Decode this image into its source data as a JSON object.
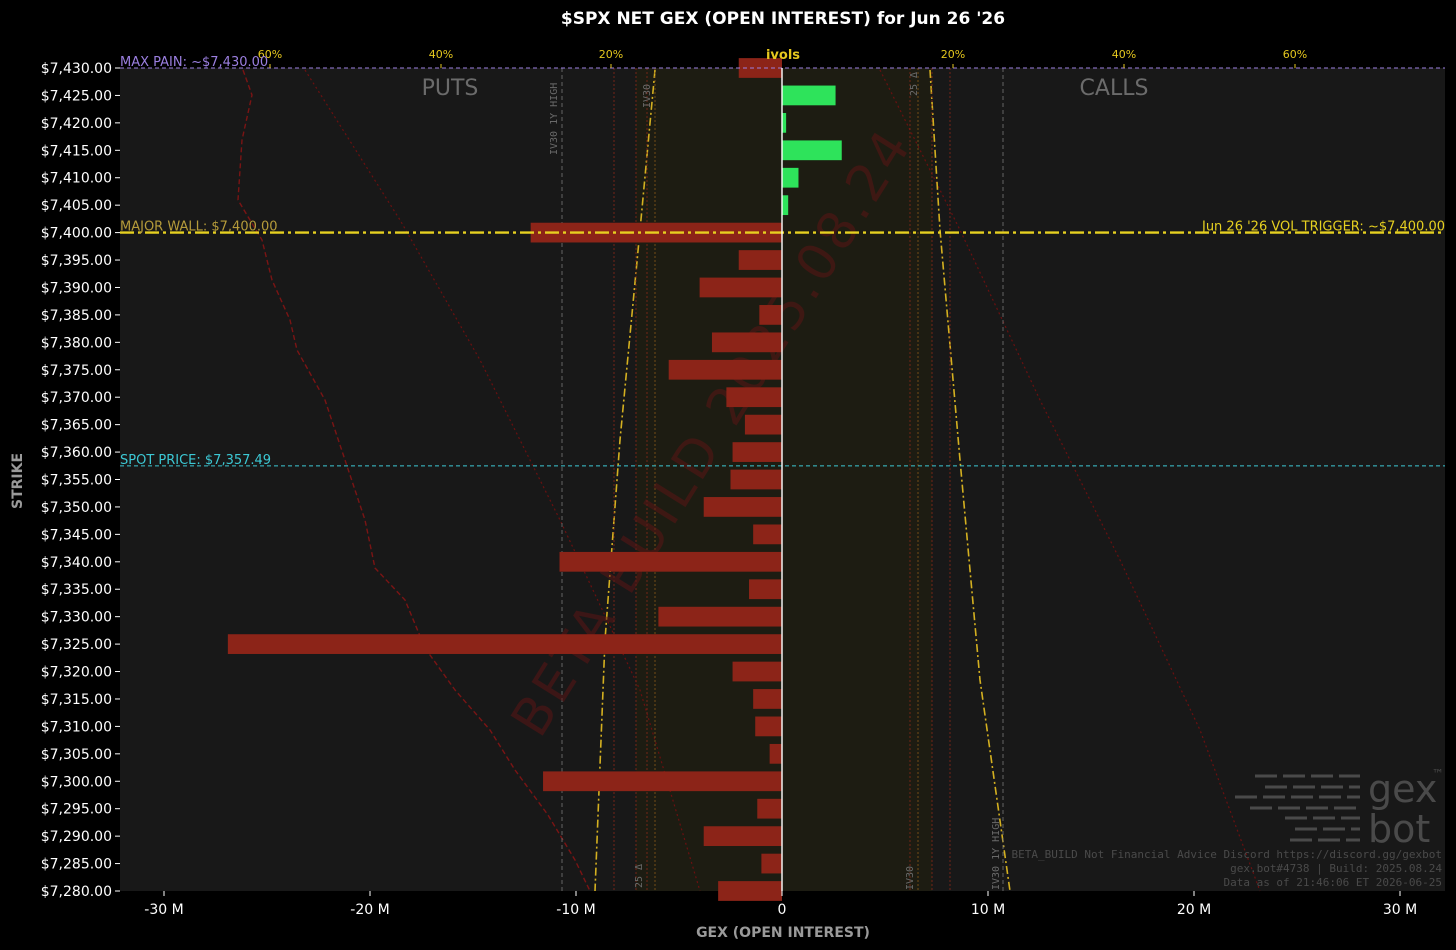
{
  "chart_data": {
    "type": "bar",
    "orientation": "horizontal",
    "title": "$SPX NET GEX (OPEN INTEREST) for Jun 26 '26",
    "xlabel": "GEX (OPEN INTEREST)",
    "ylabel": "STRIKE",
    "xlim": [
      -33,
      32
    ],
    "ylim": [
      7280,
      7430
    ],
    "x_ticks": [
      -30,
      -20,
      -10,
      0,
      10,
      20,
      30
    ],
    "x_tick_labels": [
      "-30 M",
      "-20 M",
      "-10 M",
      "0",
      "10 M",
      "20 M",
      "30 M"
    ],
    "y_ticks": [
      7430,
      7425,
      7420,
      7415,
      7410,
      7405,
      7400,
      7395,
      7390,
      7385,
      7380,
      7375,
      7370,
      7365,
      7360,
      7355,
      7350,
      7345,
      7340,
      7335,
      7330,
      7325,
      7320,
      7315,
      7310,
      7305,
      7300,
      7295,
      7290,
      7285,
      7280
    ],
    "y_tick_labels": [
      "$7,430.00",
      "$7,425.00",
      "$7,420.00",
      "$7,415.00",
      "$7,410.00",
      "$7,405.00",
      "$7,400.00",
      "$7,395.00",
      "$7,390.00",
      "$7,385.00",
      "$7,380.00",
      "$7,375.00",
      "$7,370.00",
      "$7,365.00",
      "$7,360.00",
      "$7,355.00",
      "$7,350.00",
      "$7,345.00",
      "$7,340.00",
      "$7,335.00",
      "$7,330.00",
      "$7,325.00",
      "$7,320.00",
      "$7,315.00",
      "$7,310.00",
      "$7,305.00",
      "$7,300.00",
      "$7,295.00",
      "$7,290.00",
      "$7,285.00",
      "$7,280.00"
    ],
    "strikes": [
      7430,
      7425,
      7420,
      7415,
      7410,
      7405,
      7400,
      7395,
      7390,
      7385,
      7380,
      7375,
      7370,
      7365,
      7360,
      7355,
      7350,
      7345,
      7340,
      7335,
      7330,
      7325,
      7320,
      7315,
      7310,
      7305,
      7300,
      7295,
      7290,
      7285,
      7280
    ],
    "values": [
      -2.1,
      2.6,
      0.2,
      2.9,
      0.8,
      0.3,
      -12.2,
      -2.1,
      -4.0,
      -1.1,
      -3.4,
      -5.5,
      -2.7,
      -1.8,
      -2.4,
      -2.5,
      -3.8,
      -1.4,
      -10.8,
      -1.6,
      -6.0,
      -26.9,
      -2.4,
      -1.4,
      -1.3,
      -0.6,
      -11.6,
      -1.2,
      -3.8,
      -1.0,
      -3.1
    ],
    "positive_color": "#2ee35b",
    "negative_color": "#8c2418",
    "ivol_axis": {
      "label": "ivols",
      "ticks": [
        "60%",
        "40%",
        "20%",
        "20%",
        "40%",
        "60%"
      ]
    },
    "side_labels": {
      "puts": "PUTS",
      "calls": "CALLS"
    },
    "reference_lines": {
      "max_pain": {
        "label": "MAX PAIN: ~$7,430.00",
        "strike": 7430,
        "color": "#9b7fe0"
      },
      "major_wall": {
        "label": "MAJOR WALL: $7,400.00",
        "strike": 7400,
        "color": "#b59b3a"
      },
      "vol_trigger": {
        "label": "Jun 26 '26 VOL TRIGGER: ~$7,400.00",
        "strike": 7400,
        "color": "#e6d020"
      },
      "spot": {
        "label": "SPOT PRICE: $7,357.49",
        "strike": 7357.49,
        "color": "#3cc8d4"
      }
    },
    "vertical_labels": {
      "iv30_1y_high_put": "IV30 1Y HIGH",
      "iv30_put": "IV30",
      "delta25_put": "25 Δ",
      "delta25_call": "25 Δ",
      "iv30_call": "IV30",
      "iv30_1y_high_call": "IV30 1Y HIGH"
    },
    "watermark": {
      "beta": "BETA BUILD 2025.08.24",
      "line1": "BETA_BUILD Not Financial Advice Discord https://discord.gg/gexbot",
      "line2": "gex.bot#4738 | Build: 2025.08.24",
      "line3": "Data as of 21:46:06 ET 2026-06-25",
      "logo_top": "gex",
      "logo_bottom": "bot",
      "logo_mark": "™"
    }
  }
}
